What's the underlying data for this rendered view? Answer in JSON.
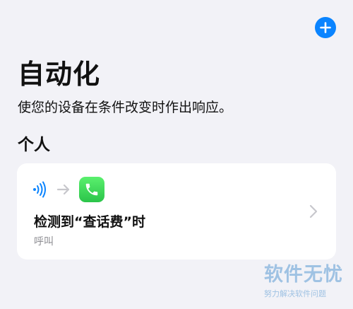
{
  "header": {
    "add_icon": "plus-icon",
    "accent_color": "#0a84ff"
  },
  "page": {
    "title": "自动化",
    "subtitle": "使您的设备在条件改变时作出响应。",
    "section_header": "个人"
  },
  "automation_card": {
    "trigger_icon": "nfc-icon",
    "arrow_icon": "arrow-right-icon",
    "app_icon": "phone-app-icon",
    "title": "检测到“查话费”时",
    "subtitle": "呼叫",
    "chevron_icon": "chevron-right-icon"
  },
  "watermark": {
    "logo_text": "软件无忧",
    "sub_text": "努力解决软件问题"
  }
}
